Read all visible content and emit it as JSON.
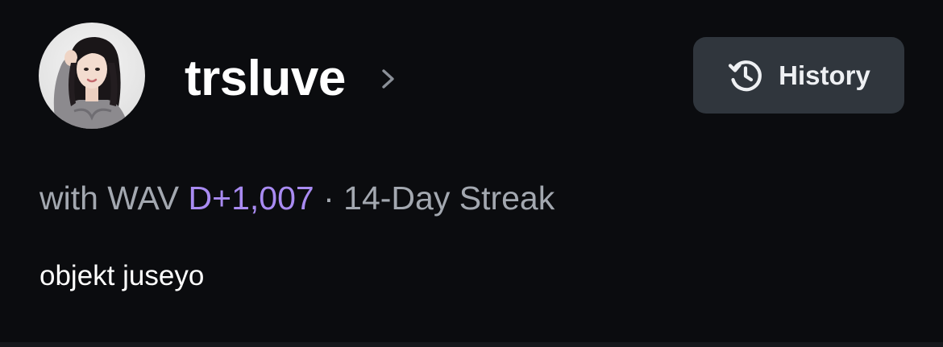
{
  "profile": {
    "username": "trsluve",
    "avatar_alt": "profile photo",
    "with_prefix": "with WAV",
    "dday": "D+1,007",
    "separator": "·",
    "streak": "14-Day Streak",
    "bio": "objekt juseyo"
  },
  "history_button": {
    "label": "History",
    "icon": "history-icon"
  },
  "icons": {
    "chevron": "chevron-right-icon"
  },
  "colors": {
    "background": "#0b0c0f",
    "button_bg": "#30363d",
    "dday_accent": "#a98bf2",
    "meta_text": "#a3a8b0"
  }
}
